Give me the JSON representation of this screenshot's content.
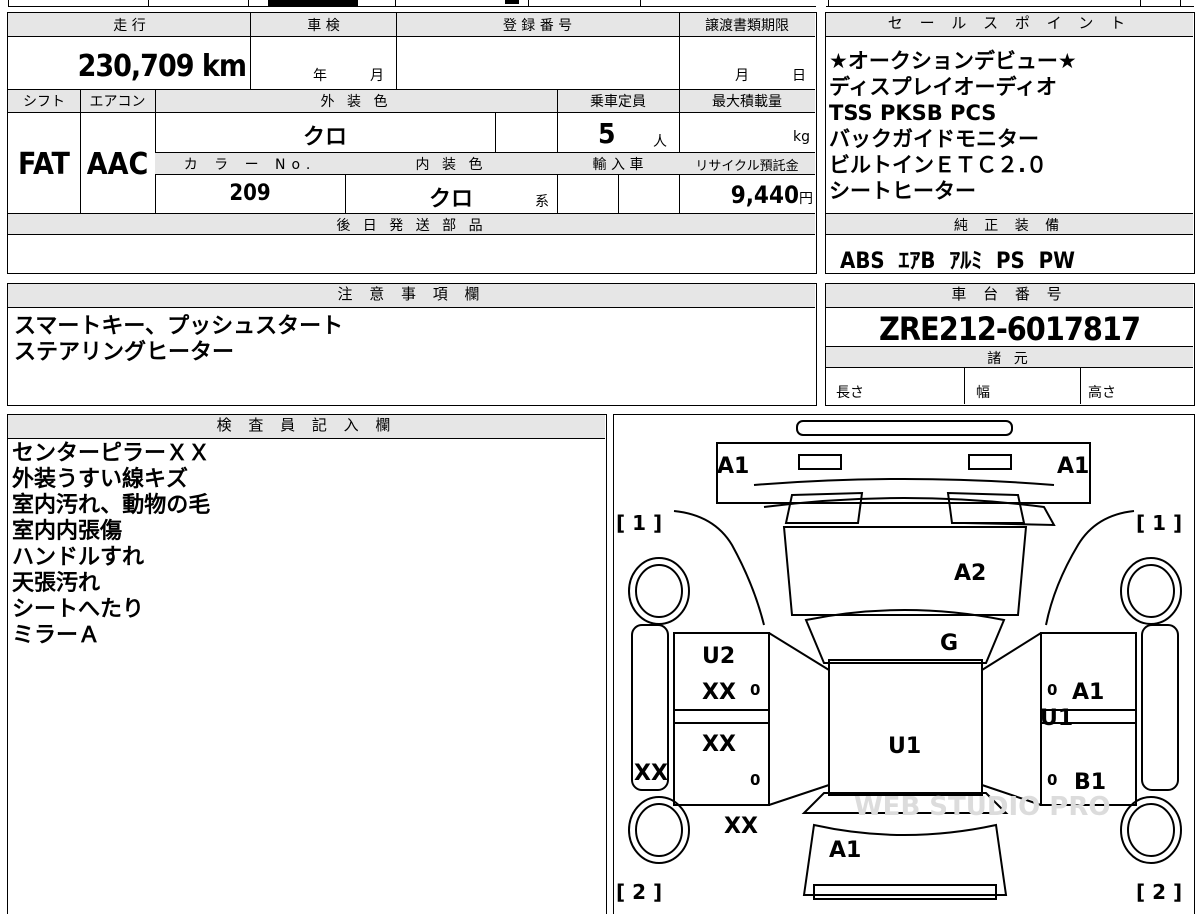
{
  "vehicle": {
    "mileage_label": "走 行",
    "mileage": "230,709",
    "mileage_unit": "km",
    "inspection_label": "車 検",
    "inspection_year_unit": "年",
    "inspection_month_unit": "月",
    "registration_label": "登 録 番 号",
    "transfer_label": "譲渡書類期限",
    "transfer_month_unit": "月",
    "transfer_day_unit": "日",
    "shift_label": "シフト",
    "shift": "FAT",
    "aircon_label": "エアコン",
    "aircon": "AAC",
    "exterior_label": "外 装 色",
    "exterior_color": "クロ",
    "color_no_label": "カ ラ ー No.",
    "color_no": "209",
    "interior_label": "内 装 色",
    "interior_color": "クロ",
    "interior_suffix": "系",
    "capacity_label": "乗車定員",
    "capacity": "5",
    "capacity_unit": "人",
    "max_load_label": "最大積載量",
    "max_load_unit": "kg",
    "import_label": "輸 入 車",
    "recycle_label": "リサイクル預託金",
    "recycle_fee": "9,440",
    "recycle_unit": "円",
    "later_parts_label": "後 日 発 送 部 品"
  },
  "sales_points": {
    "title": "セ ー ル ス ポ イ ン ト",
    "items": [
      "★オークションデビュー★",
      "ディスプレイオーディオ",
      "TSS PKSB PCS",
      "バックガイドモニター",
      "ビルトインＥＴＣ２.０",
      "シートヒーター"
    ]
  },
  "equipment": {
    "title": "純 正 装 備",
    "items": "ABS  ｴｱB  ｱﾙﾐ  PS  PW"
  },
  "notes": {
    "title": "注 意 事 項 欄",
    "lines": [
      "スマートキー、プッシュスタート",
      "ステアリングヒーター"
    ]
  },
  "chassis": {
    "title": "車 台 番 号",
    "number": "ZRE212-6017817",
    "specs_title": "諸 元",
    "length_label": "長さ",
    "width_label": "幅",
    "height_label": "高さ"
  },
  "inspector": {
    "title": "検 査 員 記 入 欄",
    "lines": [
      "センターピラーＸＸ",
      "外装うすい線キズ",
      "室内汚れ、動物の毛",
      "室内内張傷",
      "ハンドルすれ",
      "天張汚れ",
      "シートへたり",
      "ミラーＡ"
    ]
  },
  "diagram": {
    "marks": {
      "front_left": "A1",
      "front_right": "A1",
      "tire_fl": "[ 1 ]",
      "tire_fr": "[ 1 ]",
      "tire_rl": "[ 2 ]",
      "tire_rr": "[ 2 ]",
      "windshield": "A2",
      "hood_rear": "G",
      "left_front_door": "U2",
      "left_front_door2": "XX",
      "left_rear_door": "XX",
      "left_rocker": "XX",
      "left_quarter": "XX",
      "roof": "U1",
      "right_front_door": "A1",
      "right_pillar": "U1",
      "right_rear_door": "B1",
      "trunk": "A1",
      "zero": "0"
    },
    "watermark": "WEB STUDIO PRO"
  }
}
